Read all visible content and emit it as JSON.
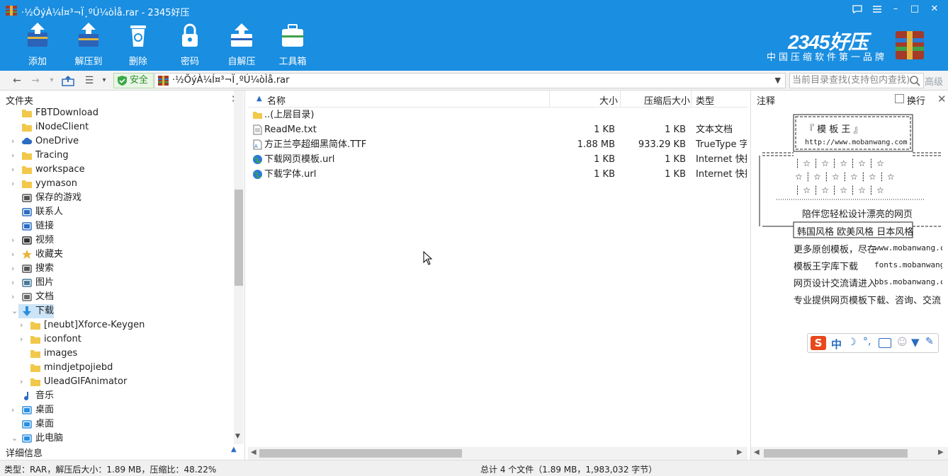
{
  "window": {
    "title": "·½ÕýÀ¼Í¤³¬Ï¸ºÚ¼òÌå.rar - 2345好压",
    "minimize": "–",
    "maximize": "□",
    "close": "✕",
    "feedback_icon": "chat-icon",
    "menu_icon": "menu-icon"
  },
  "toolbar": {
    "buttons": [
      {
        "label": "添加",
        "icon": "add-archive-icon"
      },
      {
        "label": "解压到",
        "icon": "extract-icon"
      },
      {
        "label": "删除",
        "icon": "trash-icon"
      },
      {
        "label": "密码",
        "icon": "lock-icon"
      },
      {
        "label": "自解压",
        "icon": "self-extract-icon"
      },
      {
        "label": "工具箱",
        "icon": "toolbox-icon"
      }
    ]
  },
  "brand": {
    "logo": "2345好压",
    "slogan": "中国压缩软件第一品牌"
  },
  "navbar": {
    "back": "←",
    "forward": "→",
    "up": "↑",
    "view": "☰",
    "safe_label": "安全",
    "path": "·½ÕýÀ¼Í¤³¬Ï¸ºÚ¼òÌå.rar",
    "search_placeholder": "当前目录查找(支持包内查找)",
    "advanced": "高级"
  },
  "folders": {
    "header": "文件夹",
    "close": "✕",
    "detail_header": "详细信息",
    "items": [
      {
        "label": "FBTDownload",
        "icon": "folder-icon",
        "expand": ""
      },
      {
        "label": "iNodeClient",
        "icon": "folder-icon",
        "expand": ""
      },
      {
        "label": "OneDrive",
        "icon": "cloud-icon",
        "expand": "›"
      },
      {
        "label": "Tracing",
        "icon": "folder-icon",
        "expand": "›"
      },
      {
        "label": "workspace",
        "icon": "folder-icon",
        "expand": "›"
      },
      {
        "label": "yymason",
        "icon": "folder-icon",
        "expand": "›"
      },
      {
        "label": "保存的游戏",
        "icon": "games-icon",
        "expand": ""
      },
      {
        "label": "联系人",
        "icon": "contacts-icon",
        "expand": ""
      },
      {
        "label": "链接",
        "icon": "link-icon",
        "expand": ""
      },
      {
        "label": "视频",
        "icon": "video-icon",
        "expand": "›"
      },
      {
        "label": "收藏夹",
        "icon": "star-icon",
        "expand": "›"
      },
      {
        "label": "搜索",
        "icon": "search-icon",
        "expand": "›"
      },
      {
        "label": "图片",
        "icon": "picture-icon",
        "expand": "›"
      },
      {
        "label": "文档",
        "icon": "document-icon",
        "expand": "›"
      },
      {
        "label": "下载",
        "icon": "download-icon",
        "expand": "⌄"
      },
      {
        "label": "[neubt]Xforce-Keygen",
        "icon": "folder-icon",
        "expand": "›"
      },
      {
        "label": "iconfont",
        "icon": "folder-icon",
        "expand": "›"
      },
      {
        "label": "images",
        "icon": "folder-icon",
        "expand": ""
      },
      {
        "label": "mindjetpojiebd",
        "icon": "folder-icon",
        "expand": ""
      },
      {
        "label": "UleadGIFAnimator",
        "icon": "folder-icon",
        "expand": "›"
      },
      {
        "label": "音乐",
        "icon": "music-icon",
        "expand": ""
      },
      {
        "label": "桌面",
        "icon": "desktop-icon",
        "expand": "›"
      },
      {
        "label": "桌面",
        "icon": "desktop-icon",
        "expand": ""
      },
      {
        "label": "此电脑",
        "icon": "computer-icon",
        "expand": "⌄"
      }
    ]
  },
  "filelist": {
    "columns": {
      "name": "名称",
      "size": "大小",
      "compressed": "压缩后大小",
      "type": "类型"
    },
    "rows": [
      {
        "name": "..(上层目录)",
        "size": "",
        "compressed": "",
        "type": "",
        "icon": "folder-up-icon"
      },
      {
        "name": "ReadMe.txt",
        "size": "1 KB",
        "compressed": "1 KB",
        "type": "文本文档",
        "icon": "text-file-icon"
      },
      {
        "name": "方正兰亭超细黑简体.TTF",
        "size": "1.88 MB",
        "compressed": "933.29 KB",
        "type": "TrueType 字体",
        "icon": "font-file-icon"
      },
      {
        "name": "下载网页模板.url",
        "size": "1 KB",
        "compressed": "1 KB",
        "type": "Internet 快捷方式",
        "icon": "globe-icon"
      },
      {
        "name": "下载字体.url",
        "size": "1 KB",
        "compressed": "1 KB",
        "type": "Internet 快捷方式",
        "icon": "globe-icon"
      }
    ]
  },
  "notes": {
    "header": "注释",
    "wrap_label": "换行",
    "close": "✕",
    "frame_title": "『 模 板 王 』",
    "frame_url": "http://www.mobanwang.com",
    "tagline": "陪伴您轻松设计漂亮的网页",
    "styles": "韩国风格 欧美风格 日本风格",
    "lines": [
      {
        "left": "更多原创模板，尽在",
        "right": "www.mobanwang.c"
      },
      {
        "left": "模板王字库下载",
        "right": "fonts.mobanwang"
      },
      {
        "left": "网页设计交流请进入",
        "right": "bbs.mobanwang.c"
      },
      {
        "left": "专业提供网页模板下载、咨询、交流",
        "right": ""
      }
    ]
  },
  "ime": {
    "logo": "S",
    "lang": "中"
  },
  "status": {
    "left": "类型：RAR，解压后大小：1.89 MB，压缩比：48.22%",
    "center": "总计 4 个文件（1.89 MB，1,983,032 字节）"
  },
  "colors": {
    "title_bar": "#1a8ee0",
    "safe_green": "#2e8b2e",
    "selection": "#cce4f7"
  }
}
